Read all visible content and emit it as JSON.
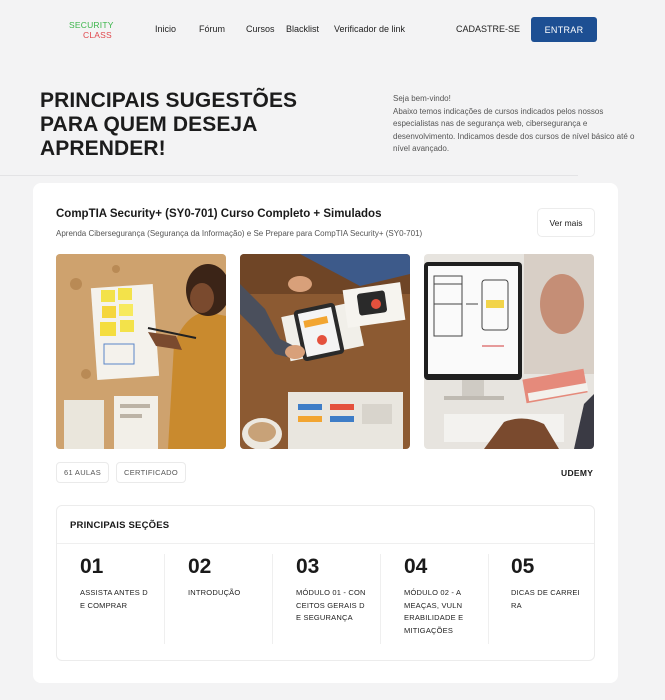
{
  "nav": {
    "logo_line1": "SECURITY",
    "logo_line2": "CLASS",
    "links": [
      "Inicio",
      "Fórum",
      "Cursos",
      "Blacklist",
      "Verificador de link"
    ],
    "signup": "CADASTRE-SE",
    "login": "ENTRAR"
  },
  "hero": {
    "title": "PRINCIPAIS SUGESTÕES PARA QUEM DESEJA APRENDER!",
    "greeting": "Seja bem-vindo!",
    "description": "Abaixo temos indicações de cursos indicados pelos nossos especialistas nas de segurança web, cibersegurança e desenvolvimento. Indicamos desde dos cursos de nível básico até o nível avançado."
  },
  "course": {
    "title": "CompTIA Security+ (SY0-701) Curso Completo + Simulados",
    "subtitle": "Aprenda Cibersegurança (Segurança da Informação) e Se Prepare para CompTIA Security+ (SY0-701)",
    "more_button": "Ver mais",
    "tags": [
      "61 AULAS",
      "CERTIFICADO"
    ],
    "platform": "UDEMY",
    "sections_title": "PRINCIPAIS SEÇÕES",
    "sections": [
      {
        "num": "01",
        "label": "ASSISTA ANTES DE COMPRAR"
      },
      {
        "num": "02",
        "label": "INTRODUÇÃO"
      },
      {
        "num": "03",
        "label": "MÓDULO 01 - CONCEITOS GERAIS DE SEGURANÇA"
      },
      {
        "num": "04",
        "label": "MÓDULO 02 - AMEAÇAS, VULNERABILIDADE E MITIGAÇÕES"
      },
      {
        "num": "05",
        "label": "DICAS DE CARREIRA"
      }
    ]
  },
  "colors": {
    "accent": "#1d4f93",
    "logo_green": "#3bb54a",
    "logo_red": "#e0474c"
  }
}
